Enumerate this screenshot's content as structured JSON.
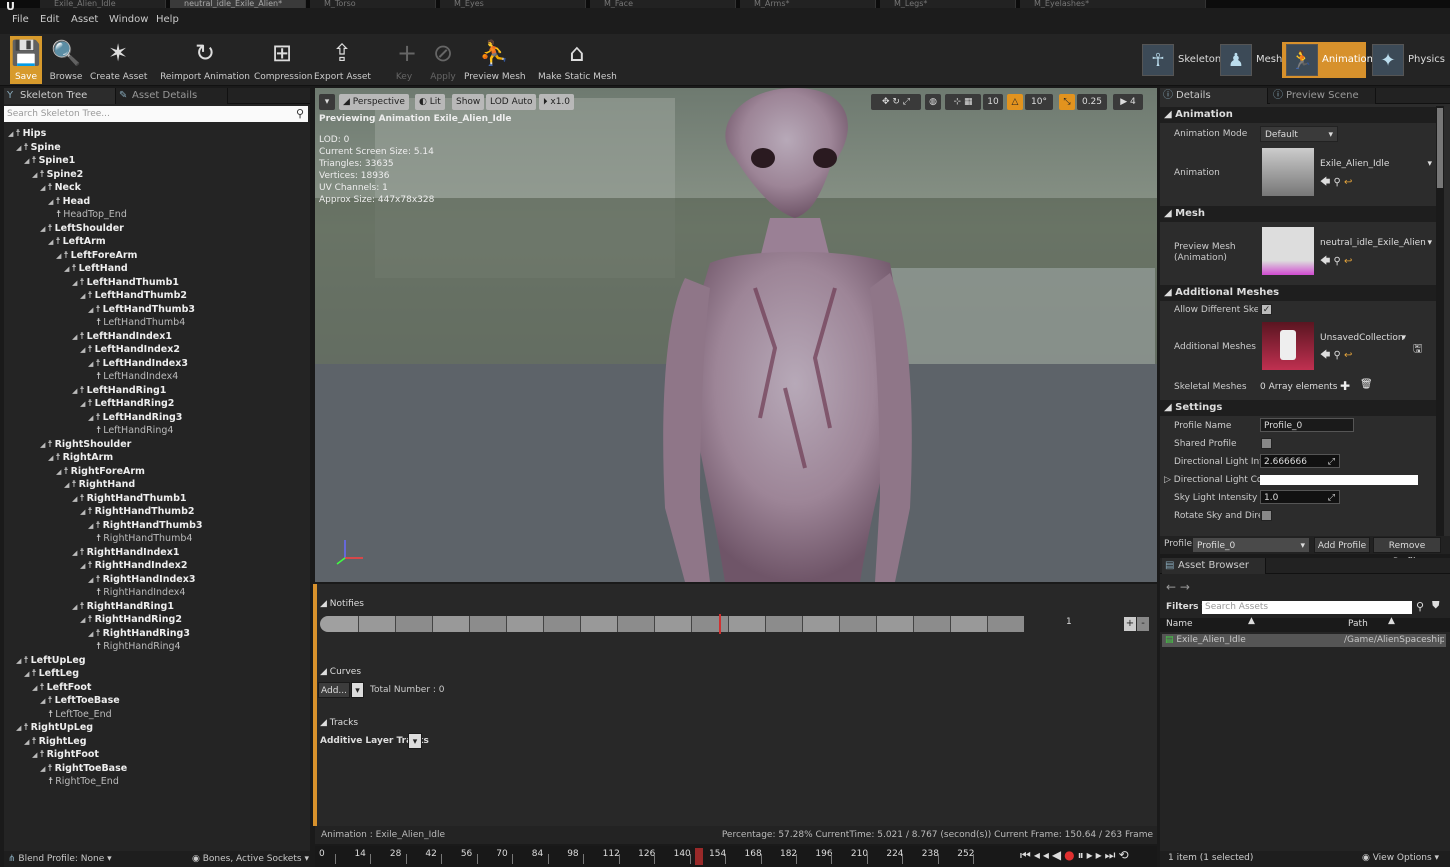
{
  "file_tabs": [
    {
      "label": "Exile_Alien_Idle",
      "active": false
    },
    {
      "label": "neutral_idle_Exile_Alien*",
      "active": true
    },
    {
      "label": "M_Torso",
      "active": false
    },
    {
      "label": "M_Eyes",
      "active": false
    },
    {
      "label": "M_Face",
      "active": false
    },
    {
      "label": "M_Arms*",
      "active": false
    },
    {
      "label": "M_Legs*",
      "active": false
    },
    {
      "label": "M_Eyelashes*",
      "active": false
    }
  ],
  "menu": [
    "File",
    "Edit",
    "Asset",
    "Window",
    "Help"
  ],
  "toolbar": {
    "items": [
      {
        "label": "Save",
        "icon": "💾"
      },
      {
        "label": "Browse",
        "icon": "🔍"
      },
      {
        "label": "Create Asset",
        "icon": "✶"
      },
      {
        "label": "Reimport Animation",
        "icon": "↻"
      },
      {
        "label": "Compression",
        "icon": "⊞"
      },
      {
        "label": "Export Asset",
        "icon": "⇪"
      },
      {
        "label": "Key",
        "icon": "+"
      },
      {
        "label": "Apply",
        "icon": "⊘"
      },
      {
        "label": "Preview Mesh",
        "icon": "⛹"
      },
      {
        "label": "Make Static Mesh",
        "icon": "⌂"
      }
    ],
    "modes": [
      {
        "label": "Skeleton",
        "icon": "☥"
      },
      {
        "label": "Mesh",
        "icon": "♟"
      },
      {
        "label": "Animation",
        "icon": "🏃"
      },
      {
        "label": "Physics",
        "icon": "✦"
      }
    ]
  },
  "left_panel": {
    "tabs": [
      "Skeleton Tree",
      "Asset Details"
    ],
    "search_placeholder": "Search Skeleton Tree...",
    "bones": [
      {
        "name": "Hips",
        "depth": 0,
        "bold": true
      },
      {
        "name": "Spine",
        "depth": 1,
        "bold": true
      },
      {
        "name": "Spine1",
        "depth": 2,
        "bold": true
      },
      {
        "name": "Spine2",
        "depth": 3,
        "bold": true
      },
      {
        "name": "Neck",
        "depth": 4,
        "bold": true
      },
      {
        "name": "Head",
        "depth": 5,
        "bold": true
      },
      {
        "name": "HeadTop_End",
        "depth": 6,
        "bold": false
      },
      {
        "name": "LeftShoulder",
        "depth": 4,
        "bold": true
      },
      {
        "name": "LeftArm",
        "depth": 5,
        "bold": true
      },
      {
        "name": "LeftForeArm",
        "depth": 6,
        "bold": true
      },
      {
        "name": "LeftHand",
        "depth": 7,
        "bold": true
      },
      {
        "name": "LeftHandThumb1",
        "depth": 8,
        "bold": true
      },
      {
        "name": "LeftHandThumb2",
        "depth": 9,
        "bold": true
      },
      {
        "name": "LeftHandThumb3",
        "depth": 10,
        "bold": true
      },
      {
        "name": "LeftHandThumb4",
        "depth": 11,
        "bold": false
      },
      {
        "name": "LeftHandIndex1",
        "depth": 8,
        "bold": true
      },
      {
        "name": "LeftHandIndex2",
        "depth": 9,
        "bold": true
      },
      {
        "name": "LeftHandIndex3",
        "depth": 10,
        "bold": true
      },
      {
        "name": "LeftHandIndex4",
        "depth": 11,
        "bold": false
      },
      {
        "name": "LeftHandRing1",
        "depth": 8,
        "bold": true
      },
      {
        "name": "LeftHandRing2",
        "depth": 9,
        "bold": true
      },
      {
        "name": "LeftHandRing3",
        "depth": 10,
        "bold": true
      },
      {
        "name": "LeftHandRing4",
        "depth": 11,
        "bold": false
      },
      {
        "name": "RightShoulder",
        "depth": 4,
        "bold": true
      },
      {
        "name": "RightArm",
        "depth": 5,
        "bold": true
      },
      {
        "name": "RightForeArm",
        "depth": 6,
        "bold": true
      },
      {
        "name": "RightHand",
        "depth": 7,
        "bold": true
      },
      {
        "name": "RightHandThumb1",
        "depth": 8,
        "bold": true
      },
      {
        "name": "RightHandThumb2",
        "depth": 9,
        "bold": true
      },
      {
        "name": "RightHandThumb3",
        "depth": 10,
        "bold": true
      },
      {
        "name": "RightHandThumb4",
        "depth": 11,
        "bold": false
      },
      {
        "name": "RightHandIndex1",
        "depth": 8,
        "bold": true
      },
      {
        "name": "RightHandIndex2",
        "depth": 9,
        "bold": true
      },
      {
        "name": "RightHandIndex3",
        "depth": 10,
        "bold": true
      },
      {
        "name": "RightHandIndex4",
        "depth": 11,
        "bold": false
      },
      {
        "name": "RightHandRing1",
        "depth": 8,
        "bold": true
      },
      {
        "name": "RightHandRing2",
        "depth": 9,
        "bold": true
      },
      {
        "name": "RightHandRing3",
        "depth": 10,
        "bold": true
      },
      {
        "name": "RightHandRing4",
        "depth": 11,
        "bold": false
      },
      {
        "name": "LeftUpLeg",
        "depth": 1,
        "bold": true
      },
      {
        "name": "LeftLeg",
        "depth": 2,
        "bold": true
      },
      {
        "name": "LeftFoot",
        "depth": 3,
        "bold": true
      },
      {
        "name": "LeftToeBase",
        "depth": 4,
        "bold": true
      },
      {
        "name": "LeftToe_End",
        "depth": 5,
        "bold": false
      },
      {
        "name": "RightUpLeg",
        "depth": 1,
        "bold": true
      },
      {
        "name": "RightLeg",
        "depth": 2,
        "bold": true
      },
      {
        "name": "RightFoot",
        "depth": 3,
        "bold": true
      },
      {
        "name": "RightToeBase",
        "depth": 4,
        "bold": true
      },
      {
        "name": "RightToe_End",
        "depth": 5,
        "bold": false
      }
    ],
    "blend_profile": "Blend Profile: None",
    "bones_filter": "Bones, Active Sockets"
  },
  "viewport": {
    "buttons": {
      "perspective": "Perspective",
      "lit": "Lit",
      "show": "Show",
      "lod": "LOD Auto",
      "speed": "x1.0"
    },
    "right_controls": {
      "grid": "10",
      "angle": "10°",
      "scale": "0.25",
      "camera": "4"
    },
    "previewing": "Previewing Animation Exile_Alien_Idle",
    "stats": [
      "LOD: 0",
      "Current Screen Size: 5.14",
      "Triangles: 33635",
      "Vertices: 18936",
      "UV Channels: 1",
      "Approx Size: 447x78x328"
    ]
  },
  "sequencer": {
    "notifies_label": "Notifies",
    "track_number": "1",
    "curves_label": "Curves",
    "add_label": "Add...",
    "total_number": "Total Number : 0",
    "tracks_label": "Tracks",
    "additive_label": "Additive Layer Tracks",
    "status_left": "Animation : Exile_Alien_Idle",
    "status_right": "Percentage: 57.28% CurrentTime: 5.021 / 8.767 (second(s)) Current Frame: 150.64 / 263 Frame",
    "frame_ticks": [
      "0",
      "14",
      "28",
      "42",
      "56",
      "70",
      "84",
      "98",
      "112",
      "126",
      "140",
      "154",
      "168",
      "182",
      "196",
      "210",
      "224",
      "238",
      "252"
    ],
    "playhead_fraction": 0.5728
  },
  "details": {
    "tabs": [
      "Details",
      "Preview Scene Sett"
    ],
    "sections": {
      "animation": "Animation",
      "mesh": "Mesh",
      "additional": "Additional Meshes",
      "settings": "Settings"
    },
    "animation_mode_label": "Animation Mode",
    "animation_mode_value": "Default",
    "animation_label": "Animation",
    "animation_value": "Exile_Alien_Idle",
    "preview_mesh_label": "Preview Mesh (Animation)",
    "preview_mesh_value": "neutral_idle_Exile_Alien",
    "allow_diff_label": "Allow Different Skelet",
    "additional_meshes_label": "Additional Meshes",
    "additional_meshes_value": "UnsavedCollection",
    "skeletal_meshes_label": "Skeletal Meshes",
    "skeletal_meshes_value": "0 Array elements",
    "profile_name_label": "Profile Name",
    "profile_name_value": "Profile_0",
    "shared_profile_label": "Shared Profile",
    "dir_intensity_label": "Directional Light Inten",
    "dir_intensity_value": "2.666666",
    "dir_color_label": "Directional Light Colo",
    "sky_intensity_label": "Sky Light Intensity",
    "sky_intensity_value": "1.0",
    "rotate_sky_label": "Rotate Sky and Direct",
    "profile_footer_label": "Profile",
    "profile_footer_value": "Profile_0",
    "add_profile": "Add Profile",
    "remove_profile": "Remove Profile"
  },
  "asset_browser": {
    "tab": "Asset Browser",
    "filters": "Filters",
    "search_placeholder": "Search Assets",
    "col_name": "Name",
    "col_path": "Path",
    "rows": [
      {
        "name": "Exile_Alien_Idle",
        "path": "/Game/AlienSpaceship"
      }
    ],
    "count": "1 item (1 selected)",
    "view_options": "View Options"
  },
  "colors": {
    "accent": "#d7912c",
    "selected_row": "#555555",
    "playhead": "#d03030"
  }
}
